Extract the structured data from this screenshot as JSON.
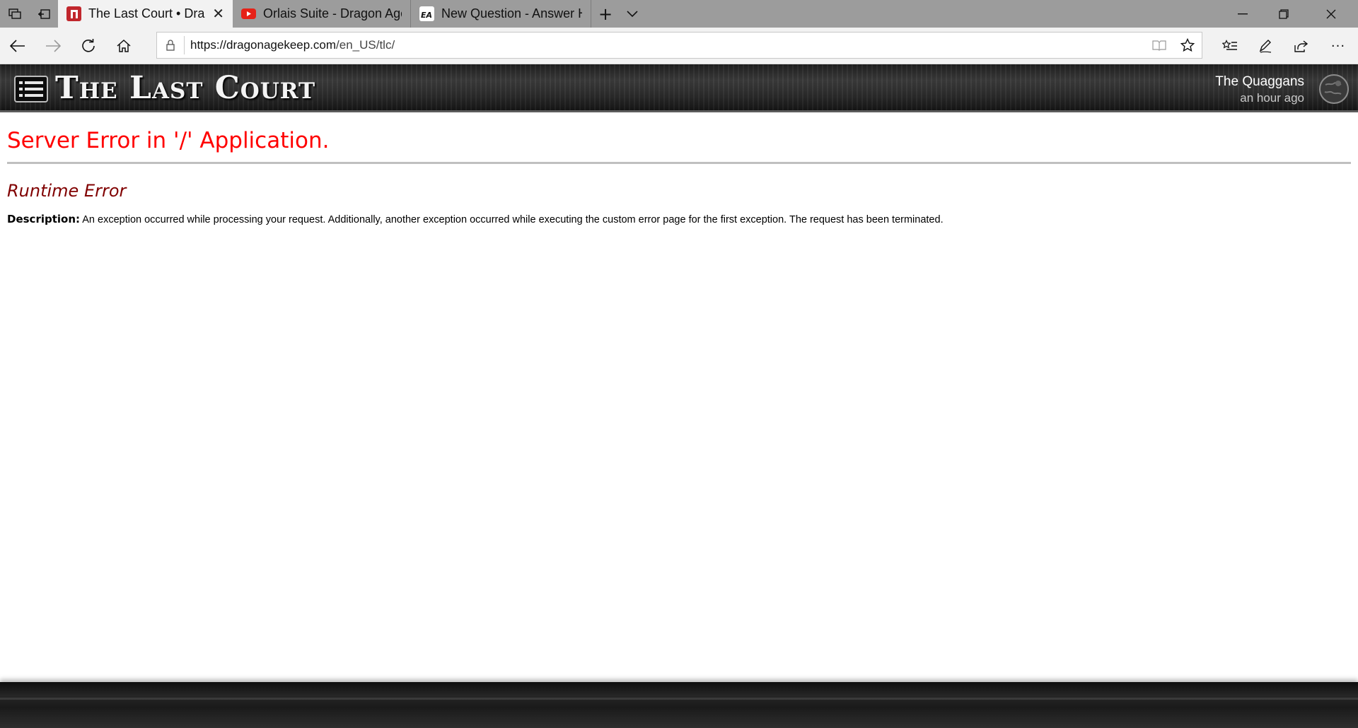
{
  "browser": {
    "tabs": [
      {
        "title": "The Last Court • Dragor",
        "active": true,
        "favicon": "last-court-favicon"
      },
      {
        "title": "Orlais Suite - Dragon Age Ir",
        "active": false,
        "favicon": "youtube-favicon"
      },
      {
        "title": "New Question - Answer HQ",
        "active": false,
        "favicon": "ea-favicon"
      }
    ],
    "url": {
      "host": "https://dragonagekeep.com",
      "path": "/en_US/tlc/"
    }
  },
  "header": {
    "site_title": "The Last Court",
    "user_name": "The Quaggans",
    "user_time": "an hour ago"
  },
  "error": {
    "title": "Server Error in '/' Application.",
    "subtitle": "Runtime Error",
    "description_label": "Description:",
    "description_text": "An exception occurred while processing your request. Additionally, another exception occurred while executing the custom error page for the first exception. The request has been terminated."
  },
  "colors": {
    "error_title": "#ff0000",
    "error_subtitle": "#800000",
    "header_bg": "#2a2a2a"
  }
}
